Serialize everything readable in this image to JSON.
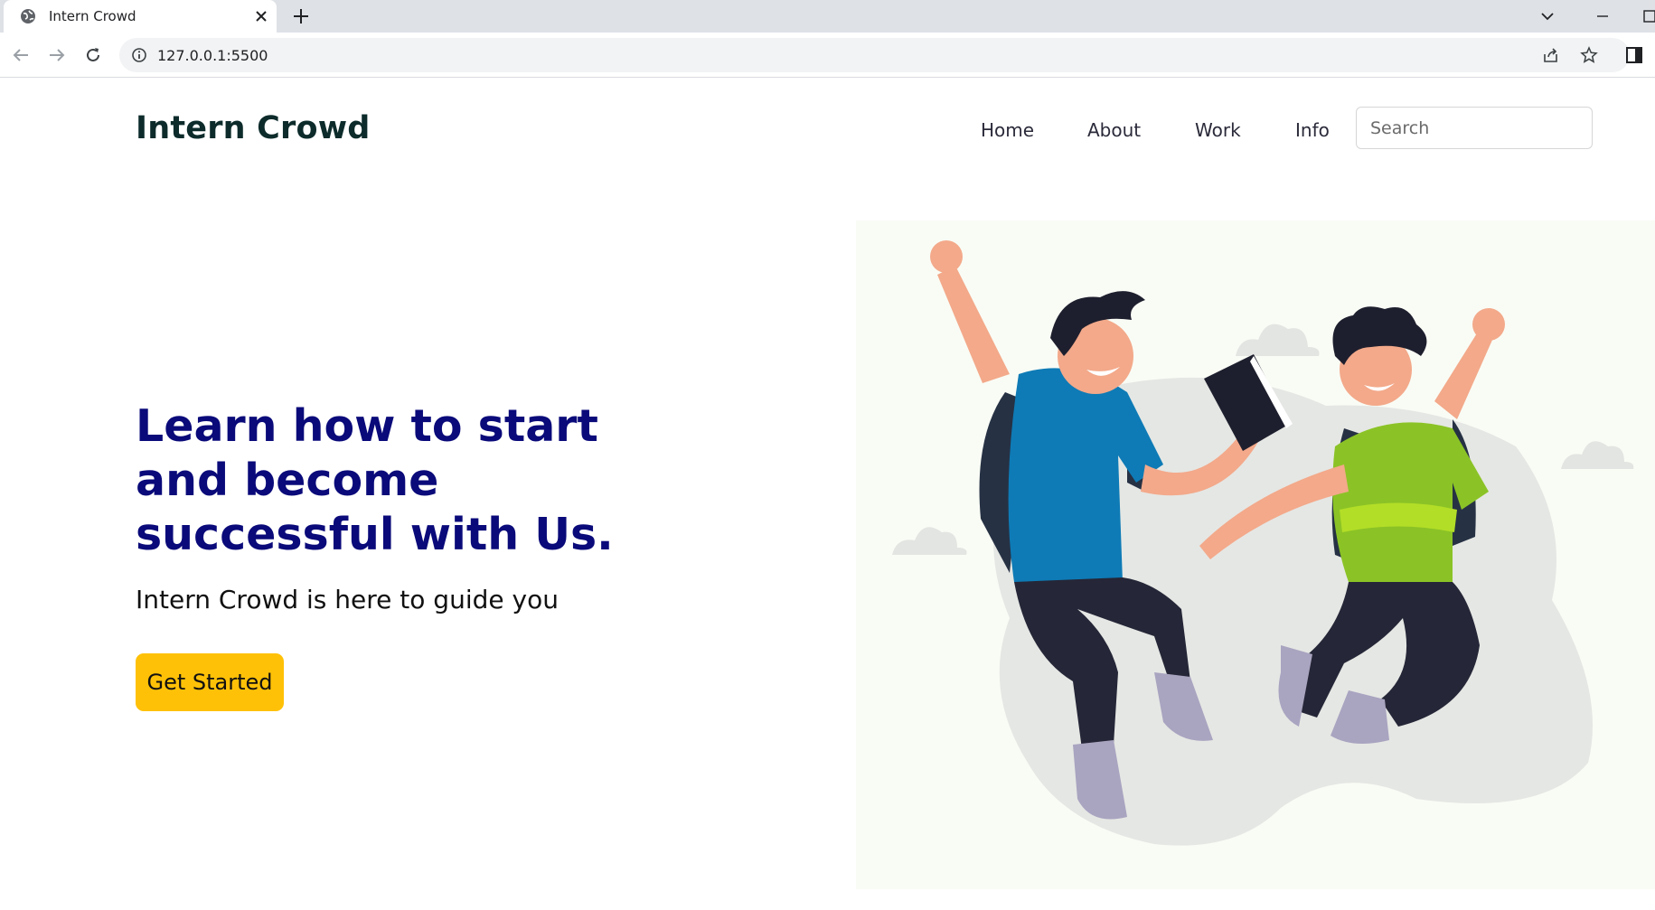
{
  "browser": {
    "tab_title": "Intern Crowd",
    "url": "127.0.0.1:5500"
  },
  "nav": {
    "brand": "Intern Crowd",
    "links": [
      "Home",
      "About",
      "Work",
      "Info"
    ],
    "search_placeholder": "Search"
  },
  "hero": {
    "title": "Learn how to start and become successful with Us.",
    "subtitle": "Intern Crowd is here to guide you",
    "cta_label": "Get Started"
  },
  "colors": {
    "accent": "#ffc107",
    "heading": "#0a0a7a",
    "shirt_blue": "#0e7bb6",
    "shirt_green": "#8bc326"
  }
}
